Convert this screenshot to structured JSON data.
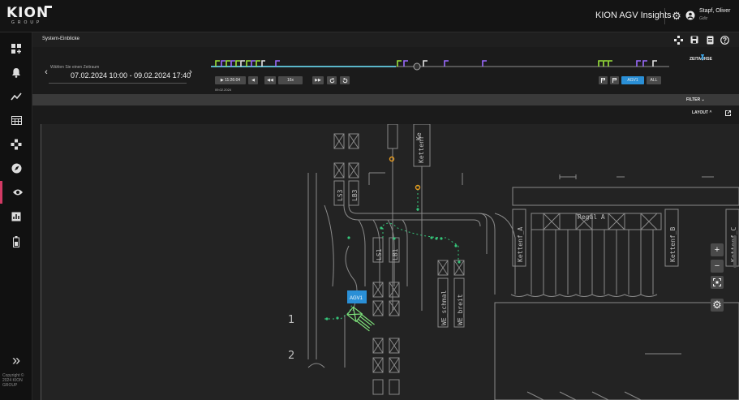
{
  "brand": {
    "logo": "KION",
    "logo_sub": "GROUP"
  },
  "header": {
    "app_title": "KION AGV Insights",
    "user_name": "Stapf, Oliver",
    "user_org": "Gdiz",
    "icons": [
      "gear-icon",
      "user-icon"
    ]
  },
  "sidebar": {
    "items": [
      {
        "icon": "dashboard-add-icon",
        "glyph": "▦"
      },
      {
        "icon": "bell-icon",
        "glyph": "🔔"
      },
      {
        "icon": "trend-icon",
        "glyph": "〰"
      },
      {
        "icon": "table-icon",
        "glyph": "▤"
      },
      {
        "icon": "network-icon",
        "glyph": "✣"
      },
      {
        "icon": "compass-icon",
        "glyph": "◉"
      },
      {
        "icon": "eye-icon",
        "glyph": "◉",
        "active": true
      },
      {
        "icon": "chart-icon",
        "glyph": "▥"
      },
      {
        "icon": "battery-icon",
        "glyph": "▮"
      }
    ],
    "expand_glyph": "»",
    "copyright": "Copyright © 2024 KION GROUP"
  },
  "page": {
    "title": "System-Einblicke",
    "tools": [
      "move-icon",
      "save-icon",
      "file-icon",
      "help-icon"
    ]
  },
  "period": {
    "hint": "Wählen Sie einen Zeitraum",
    "value": "07.02.2024 10:00 - 09.02.2024 17:40",
    "prev": "‹",
    "next": "›"
  },
  "timeline": {
    "zeitachse_label": "ZEITACHSE",
    "play_label": "▶ 11:26:04",
    "step_back": "◀",
    "rewind": "◀◀",
    "speed": "16x",
    "forward": "▶▶",
    "date_under": "09.02.2024",
    "agv_label": "AGV1",
    "all_label": "ALL"
  },
  "filter_label": "FILTER ⌄",
  "layout_label": "LAYOUT ^",
  "map": {
    "labels": {
      "ke": "Ke",
      "kettenf": "Kettenf",
      "ls3": "LS3",
      "lb3": "LB3",
      "ls1": "LS1",
      "lb1": "LB1",
      "we_schmal": "WE_schmal",
      "we_breit": "WE_breit",
      "kettenf_a": "Kettenf_A",
      "regal_a": "Regal A",
      "kettenf_b": "Kettenf_B",
      "kettenf_c": "Kettenf_C",
      "num1": "1",
      "num2": "2",
      "agv_tag": "AGV1"
    },
    "controls": [
      "zoom-in-icon",
      "zoom-out-icon",
      "fit-icon",
      "settings-icon"
    ],
    "colors": {
      "lines": "#8a8a8a",
      "path": "#35c57a",
      "agv": "#7de07a",
      "tag": "#2a8fd6",
      "marker": "#e69a1f"
    }
  },
  "colors": {
    "accent": "#d23a64",
    "timeline_bar": "#5ab6c9",
    "event_green": "#9ae23a",
    "event_purple": "#9b6bff"
  }
}
